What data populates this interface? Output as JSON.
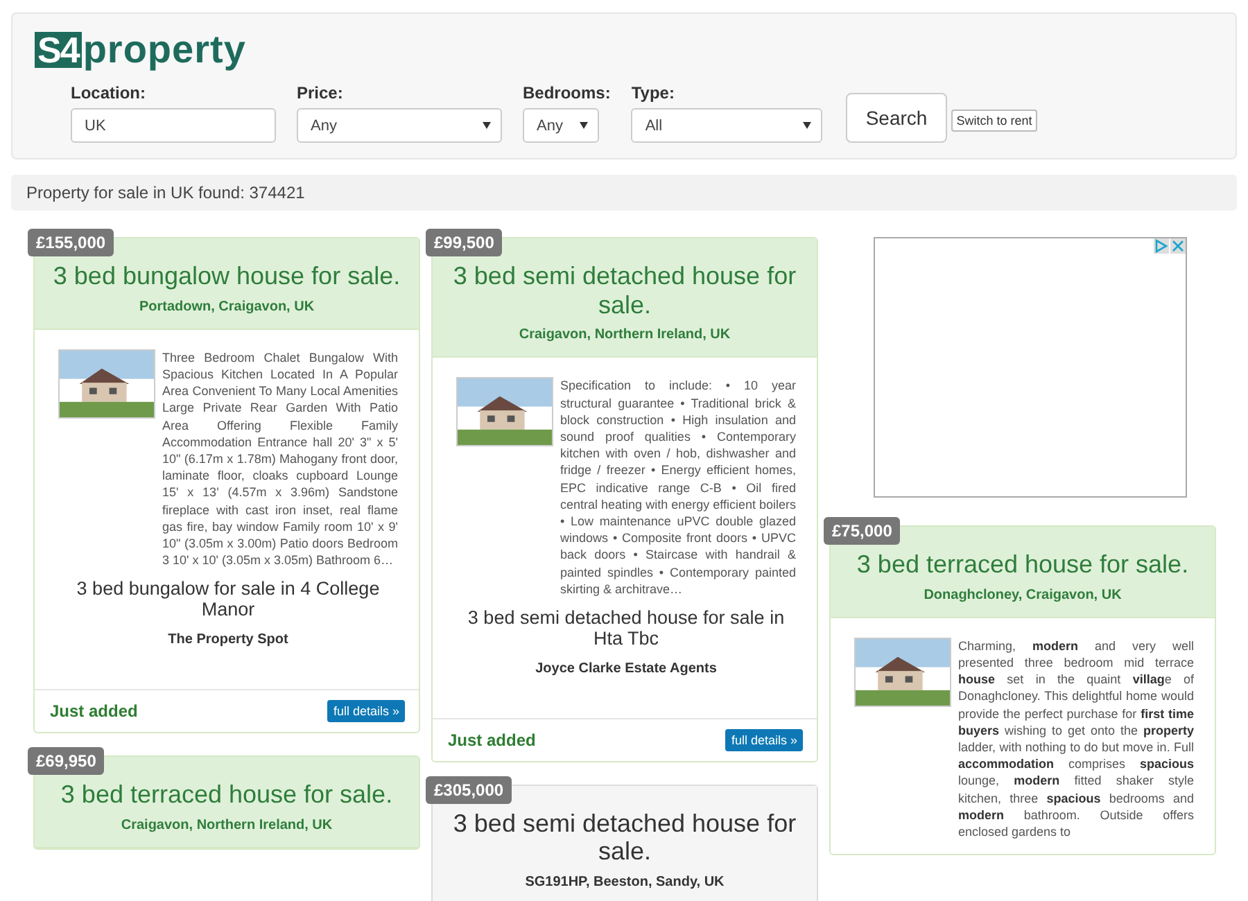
{
  "logo": {
    "mark": "S4",
    "text": "property"
  },
  "search_form": {
    "fields": [
      {
        "kind": "text",
        "label": "Location:",
        "value": "UK"
      },
      {
        "kind": "select",
        "label": "Price:",
        "value": "Any"
      },
      {
        "kind": "select",
        "label": "Bedrooms:",
        "value": "Any"
      },
      {
        "kind": "select",
        "label": "Type:",
        "value": "All"
      }
    ],
    "search_button": "Search",
    "switch_button": "Switch to rent"
  },
  "results_summary": "Property for sale in UK found: 374421",
  "columns": [
    {
      "items": [
        {
          "kind": "listing",
          "highlighted": true,
          "price": "£155,000",
          "title": "3 bed bungalow house for sale.",
          "location": "Portadown, Craigavon, UK",
          "description": "Three Bedroom Chalet Bungalow With Spacious Kitchen Located In A Popular Area Convenient To Many Local Amenities Large Private Rear Garden With Patio Area Offering Flexible Family Accommodation Entrance hall 20' 3\" x 5' 10\" (6.17m x 1.78m) Mahogany front door, laminate floor, cloaks cupboard Lounge 15' x 13' (4.57m x 3.96m) Sandstone fireplace with cast iron inset, real flame gas fire, bay window Family room 10' x 9' 10\" (3.05m x 3.00m) Patio doors Bedroom 3 10' x 10' (3.05m x 3.05m) Bathroom 6…",
          "listing_title": "3 bed bungalow for sale in 4 College Manor",
          "agent": "The Property Spot",
          "status": "Just added",
          "details_link": "full details »"
        },
        {
          "kind": "listing",
          "highlighted": true,
          "price": "£69,950",
          "title": "3 bed terraced house for sale.",
          "location": "Craigavon, Northern Ireland, UK"
        }
      ]
    },
    {
      "items": [
        {
          "kind": "listing",
          "highlighted": true,
          "price": "£99,500",
          "title": "3 bed semi detached house for sale.",
          "location": "Craigavon, Northern Ireland, UK",
          "description": "Specification to include: • 10 year structural guarantee • Traditional brick & block construction • High insulation and sound proof qualities • Contemporary kitchen with oven / hob, dishwasher and fridge / freezer • Energy efficient homes, EPC indicative range C-B • Oil fired central heating with energy efficient boilers • Low maintenance uPVC double glazed windows • Composite front doors • UPVC back doors • Staircase with handrail & painted spindles • Contemporary painted skirting & architrave…",
          "listing_title": "3 bed semi detached house for sale in Hta Tbc",
          "agent": "Joyce Clarke Estate Agents",
          "status": "Just added",
          "details_link": "full details »"
        },
        {
          "kind": "listing",
          "highlighted": false,
          "price": "£305,000",
          "title": "3 bed semi detached house for sale.",
          "location": "SG191HP, Beeston, Sandy, UK"
        }
      ]
    },
    {
      "items": [
        {
          "kind": "ad"
        },
        {
          "kind": "listing",
          "highlighted": true,
          "price": "£75,000",
          "title": "3 bed terraced house for sale.",
          "location": "Donaghcloney, Craigavon, UK",
          "description": "Charming, **modern** and very well presented three bedroom mid terrace **house** set in the quaint **villag**e of Donaghcloney. This delightful home would provide the perfect purchase for **first time buyers** wishing to get onto the **property** ladder, with nothing to do but move in. Full **accommodation** comprises **spacious** lounge, **modern** fitted shaker style kitchen, three **spacious** bedrooms and **modern** bathroom. Outside offers enclosed gardens to"
        }
      ]
    }
  ]
}
